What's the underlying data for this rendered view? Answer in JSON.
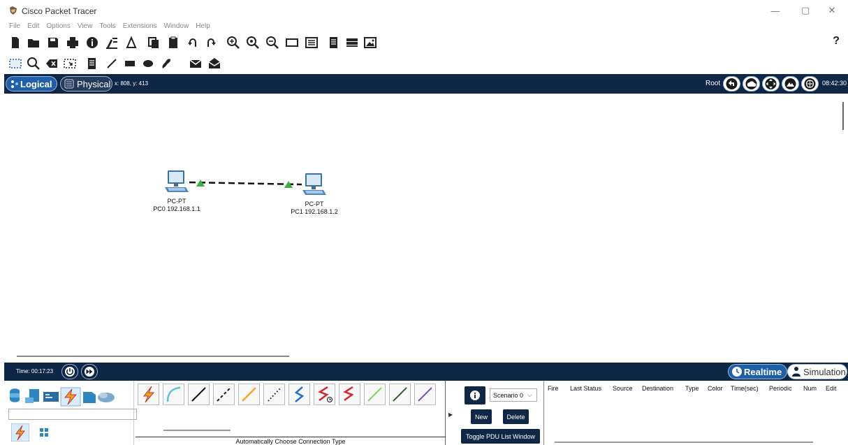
{
  "window": {
    "title": "Cisco Packet Tracer",
    "minimize_glyph": "—",
    "restore_glyph": "▢",
    "close_glyph": "✕"
  },
  "menu": [
    "File",
    "Edit",
    "Options",
    "View",
    "Tools",
    "Extensions",
    "Window",
    "Help"
  ],
  "toolbar": {
    "icons": [
      "new-icon",
      "open-icon",
      "save-icon",
      "print-icon",
      "info-icon",
      "activity-wizard-icon",
      "custom-device-icon",
      "copy-icon",
      "paste-icon",
      "undo-icon",
      "redo-icon",
      "zoom-in-icon",
      "zoom-reset-icon",
      "zoom-out-icon",
      "rectangle-icon",
      "palette-icon",
      "notes-icon",
      "device-template-icon",
      "image-icon"
    ],
    "help_label": "?"
  },
  "toolbar2": {
    "icons": [
      "select-icon",
      "inspect-icon",
      "delete-icon",
      "resize-icon",
      "note-icon",
      "line-icon",
      "rectangle-fill-icon",
      "ellipse-icon",
      "freeform-icon",
      "simple-pdu-icon",
      "complex-pdu-icon"
    ]
  },
  "modebar": {
    "logical_label": "Logical",
    "physical_label": "Physical",
    "coords": "x: 808, y: 413",
    "root_label": "Root",
    "clock": "08:42:30"
  },
  "devices": [
    {
      "type_label": "PC-PT",
      "name_label": "PC0 192.168.1.1"
    },
    {
      "type_label": "PC-PT",
      "name_label": "PC1 192.168.1.2"
    }
  ],
  "timebar": {
    "time_label": "Time: 00:17:23",
    "realtime_label": "Realtime",
    "simulation_label": "Simulation"
  },
  "connections": {
    "caption": "Automatically Choose Connection Type",
    "types": [
      "automatic-connection-icon",
      "console-cable-icon",
      "copper-straight-through-icon",
      "copper-cross-over-icon",
      "fiber-icon",
      "phone-cable-icon",
      "coaxial-icon",
      "serial-dce-icon",
      "serial-dte-icon",
      "octal-cable-icon",
      "iot-custom-cable-icon",
      "usb-cable-icon"
    ]
  },
  "scenario": {
    "selected": "Scenario 0",
    "new_label": "New",
    "delete_label": "Delete",
    "toggle_label": "Toggle PDU List Window"
  },
  "pdu_columns": [
    "Fire",
    "Last Status",
    "Source",
    "Destination",
    "Type",
    "Color",
    "Time(sec)",
    "Periodic",
    "Num",
    "Edit"
  ],
  "colors": {
    "dark_bar": "#0f2747",
    "active_tab": "#1f5fa8",
    "link_light": "#3cb043"
  }
}
